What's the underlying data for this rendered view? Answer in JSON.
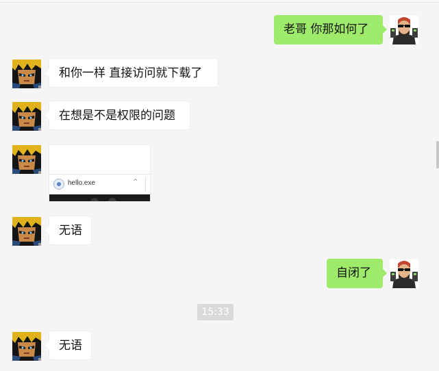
{
  "messages": [
    {
      "side": "right",
      "text": "老哥 你那如何了"
    },
    {
      "side": "left",
      "text": "和你一样 直接访问就下载了"
    },
    {
      "side": "left",
      "text": "在想是不是权限的问题"
    },
    {
      "side": "left",
      "type": "image",
      "file_name": "hello.exe"
    },
    {
      "side": "left",
      "text": "无语"
    },
    {
      "side": "right",
      "text": "自闭了"
    },
    {
      "side": "left",
      "text": "无语"
    }
  ],
  "timestamp": "15:33",
  "icons": {
    "my_avatar": "avatar-sunglasses-man",
    "friend_avatar": "avatar-anime-character",
    "download_file": "file-globe-icon",
    "chevron": "chevron-up-icon"
  },
  "colors": {
    "background": "#f5f5f5",
    "my_bubble": "#9eea6a",
    "their_bubble": "#ffffff",
    "timestamp_badge": "#dadada"
  }
}
